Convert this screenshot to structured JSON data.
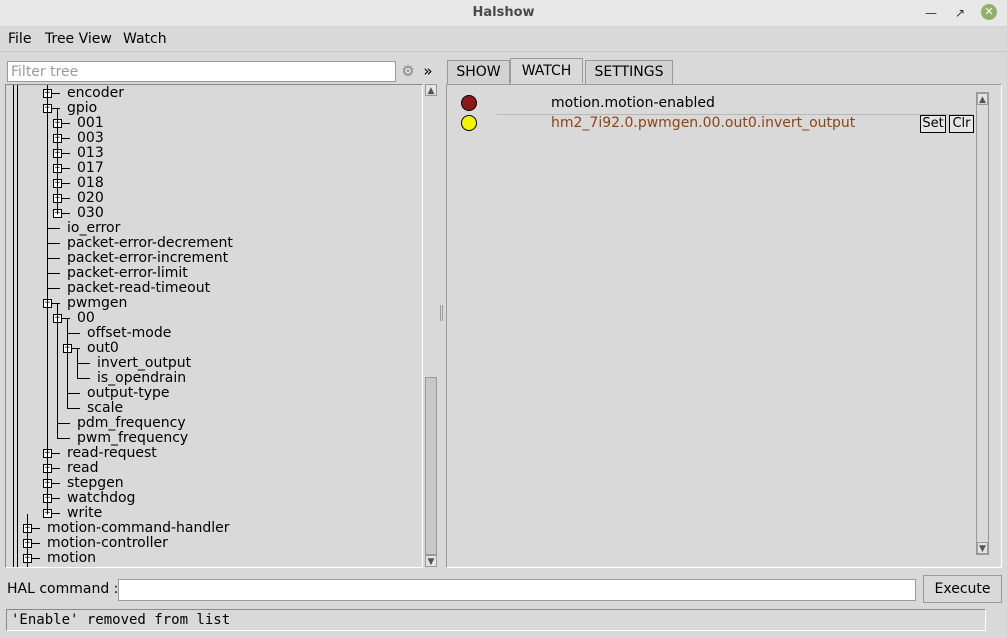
{
  "window": {
    "title": "Halshow"
  },
  "menu": [
    "File",
    "Tree View",
    "Watch"
  ],
  "filter": {
    "placeholder": "Filter tree",
    "value": ""
  },
  "tree": {
    "rows": [
      {
        "label": "encoder",
        "level": 3,
        "expander": "plus"
      },
      {
        "label": "gpio",
        "level": 3,
        "expander": "minus"
      },
      {
        "label": "001",
        "level": 4,
        "expander": "plus"
      },
      {
        "label": "003",
        "level": 4,
        "expander": "plus"
      },
      {
        "label": "013",
        "level": 4,
        "expander": "plus"
      },
      {
        "label": "017",
        "level": 4,
        "expander": "plus"
      },
      {
        "label": "018",
        "level": 4,
        "expander": "plus"
      },
      {
        "label": "020",
        "level": 4,
        "expander": "plus"
      },
      {
        "label": "030",
        "level": 4,
        "expander": "plus"
      },
      {
        "label": "io_error",
        "level": 3,
        "expander": "none"
      },
      {
        "label": "packet-error-decrement",
        "level": 3,
        "expander": "none"
      },
      {
        "label": "packet-error-increment",
        "level": 3,
        "expander": "none"
      },
      {
        "label": "packet-error-limit",
        "level": 3,
        "expander": "none"
      },
      {
        "label": "packet-read-timeout",
        "level": 3,
        "expander": "none"
      },
      {
        "label": "pwmgen",
        "level": 3,
        "expander": "minus"
      },
      {
        "label": "00",
        "level": 4,
        "expander": "minus"
      },
      {
        "label": "offset-mode",
        "level": 5,
        "expander": "none"
      },
      {
        "label": "out0",
        "level": 5,
        "expander": "minus"
      },
      {
        "label": "invert_output",
        "level": 6,
        "expander": "none"
      },
      {
        "label": "is_opendrain",
        "level": 6,
        "expander": "none"
      },
      {
        "label": "output-type",
        "level": 5,
        "expander": "none"
      },
      {
        "label": "scale",
        "level": 5,
        "expander": "none"
      },
      {
        "label": "pdm_frequency",
        "level": 4,
        "expander": "none"
      },
      {
        "label": "pwm_frequency",
        "level": 4,
        "expander": "none"
      },
      {
        "label": "read-request",
        "level": 3,
        "expander": "plus"
      },
      {
        "label": "read",
        "level": 3,
        "expander": "plus"
      },
      {
        "label": "stepgen",
        "level": 3,
        "expander": "plus"
      },
      {
        "label": "watchdog",
        "level": 3,
        "expander": "plus"
      },
      {
        "label": "write",
        "level": 3,
        "expander": "plus"
      },
      {
        "label": "motion-command-handler",
        "level": 1,
        "expander": "plus"
      },
      {
        "label": "motion-controller",
        "level": 1,
        "expander": "plus"
      },
      {
        "label": "motion",
        "level": 1,
        "expander": "plus"
      }
    ]
  },
  "tabs": [
    {
      "label": "SHOW",
      "active": false
    },
    {
      "label": "WATCH",
      "active": true
    },
    {
      "label": "SETTINGS",
      "active": false
    }
  ],
  "watch": {
    "items": [
      {
        "name": "motion.motion-enabled",
        "led_color": "#8b1a1a",
        "text_color": "#000000",
        "buttons": []
      },
      {
        "name": "hm2_7i92.0.pwmgen.00.out0.invert_output",
        "led_color": "#f5f500",
        "text_color": "#8b4513",
        "buttons": [
          "Set",
          "Clr"
        ]
      }
    ]
  },
  "hal": {
    "label": "HAL command :",
    "value": "",
    "execute_label": "Execute"
  },
  "status": {
    "text": "'Enable' removed from list"
  }
}
